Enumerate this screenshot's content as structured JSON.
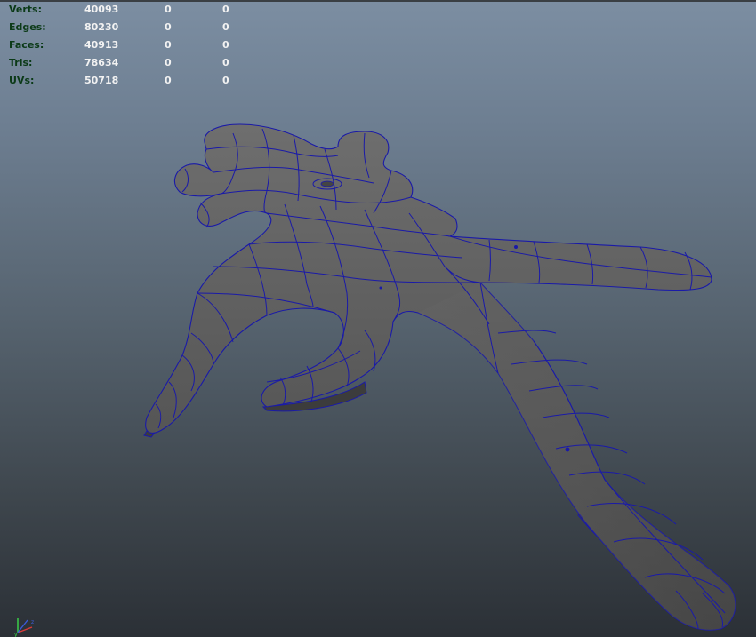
{
  "hud": {
    "rows": [
      {
        "label": "Verts:",
        "total": "40093",
        "selected": "0",
        "component": "0"
      },
      {
        "label": "Edges:",
        "total": "80230",
        "selected": "0",
        "component": "0"
      },
      {
        "label": "Faces:",
        "total": "40913",
        "selected": "0",
        "component": "0"
      },
      {
        "label": "Tris:",
        "total": "78634",
        "selected": "0",
        "component": "0"
      },
      {
        "label": "UVs:",
        "total": "50718",
        "selected": "0",
        "component": "0"
      }
    ]
  },
  "colors": {
    "hud_label": "#0b3a17",
    "hud_value": "#f2f2f2",
    "mesh_fill": "#5a5a5a",
    "wireframe": "#1a1aa8",
    "axis_x": "#d93a3a",
    "axis_y": "#3ad94a",
    "axis_z": "#3a5ad9"
  },
  "icons": [
    "view-axis-icon"
  ]
}
